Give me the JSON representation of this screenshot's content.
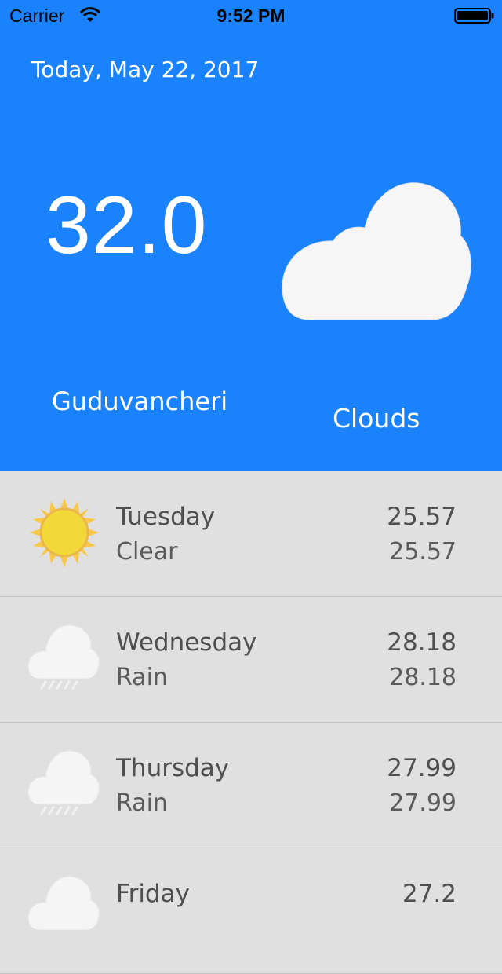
{
  "status_bar": {
    "carrier": "Carrier",
    "time": "9:52 PM"
  },
  "current": {
    "date": "Today, May 22, 2017",
    "temperature": "32.0",
    "city": "Guduvancheri",
    "condition": "Clouds",
    "icon": "cloud-icon"
  },
  "colors": {
    "header_bg": "#1a82fb",
    "list_bg": "#e0e0e0",
    "text_dark": "#4f4f4f"
  },
  "forecast": [
    {
      "day": "Tuesday",
      "condition": "Clear",
      "max": "25.57",
      "min": "25.57",
      "icon": "sun-icon"
    },
    {
      "day": "Wednesday",
      "condition": "Rain",
      "max": "28.18",
      "min": "28.18",
      "icon": "rain-cloud-icon"
    },
    {
      "day": "Thursday",
      "condition": "Rain",
      "max": "27.99",
      "min": "27.99",
      "icon": "rain-cloud-icon"
    },
    {
      "day": "Friday",
      "condition": "",
      "max": "27.2",
      "min": "",
      "icon": "cloud-icon"
    }
  ]
}
